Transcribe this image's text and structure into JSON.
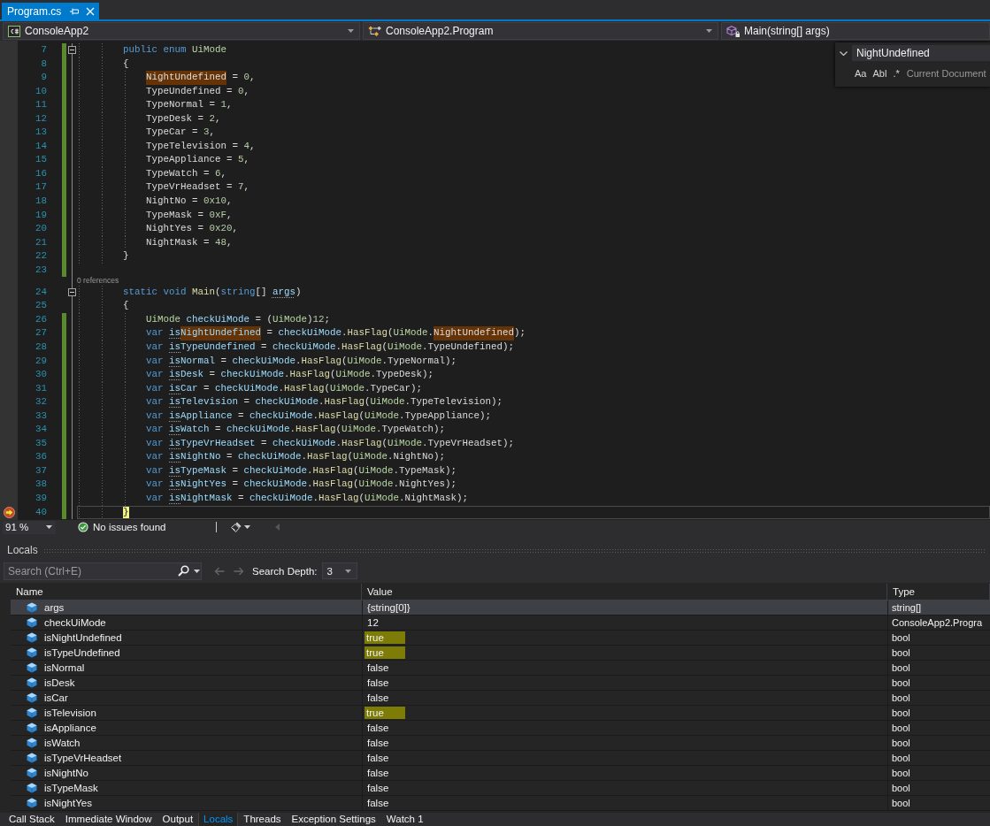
{
  "tabs": [
    {
      "label": "Program.cs",
      "selected": true
    }
  ],
  "navigation_bar": {
    "project": "ConsoleApp2",
    "type": "ConsoleApp2.Program",
    "member": "Main(string[] args)"
  },
  "editor": {
    "lines": [
      {
        "number": "7",
        "changed": true,
        "expanded": true,
        "tokens": [
          {
            "kind": "keyword",
            "text": "        public enum "
          },
          {
            "kind": "type",
            "text": "UiMode"
          }
        ]
      },
      {
        "number": "8",
        "changed": true,
        "tokens": [
          {
            "kind": "plain",
            "text": "        {"
          }
        ]
      },
      {
        "number": "9",
        "changed": true,
        "tokens": [
          {
            "kind": "member",
            "text": "            NightUndefined",
            "highlighted": true
          },
          {
            "kind": "plain",
            "text": " = "
          },
          {
            "kind": "number",
            "text": "0"
          },
          {
            "kind": "plain",
            "text": ","
          }
        ]
      },
      {
        "number": "10",
        "changed": true,
        "tokens": [
          {
            "kind": "member",
            "text": "            TypeUndefined"
          },
          {
            "kind": "plain",
            "text": " = "
          },
          {
            "kind": "number",
            "text": "0"
          },
          {
            "kind": "plain",
            "text": ","
          }
        ]
      },
      {
        "number": "11",
        "changed": true,
        "tokens": [
          {
            "kind": "member",
            "text": "            TypeNormal"
          },
          {
            "kind": "plain",
            "text": " = "
          },
          {
            "kind": "number",
            "text": "1"
          },
          {
            "kind": "plain",
            "text": ","
          }
        ]
      },
      {
        "number": "12",
        "changed": true,
        "tokens": [
          {
            "kind": "member",
            "text": "            TypeDesk"
          },
          {
            "kind": "plain",
            "text": " = "
          },
          {
            "kind": "number",
            "text": "2"
          },
          {
            "kind": "plain",
            "text": ","
          }
        ]
      },
      {
        "number": "13",
        "changed": true,
        "tokens": [
          {
            "kind": "member",
            "text": "            TypeCar"
          },
          {
            "kind": "plain",
            "text": " = "
          },
          {
            "kind": "number",
            "text": "3"
          },
          {
            "kind": "plain",
            "text": ","
          }
        ]
      },
      {
        "number": "14",
        "changed": true,
        "tokens": [
          {
            "kind": "member",
            "text": "            TypeTelevision"
          },
          {
            "kind": "plain",
            "text": " = "
          },
          {
            "kind": "number",
            "text": "4"
          },
          {
            "kind": "plain",
            "text": ","
          }
        ]
      },
      {
        "number": "15",
        "changed": true,
        "tokens": [
          {
            "kind": "member",
            "text": "            TypeAppliance"
          },
          {
            "kind": "plain",
            "text": " = "
          },
          {
            "kind": "number",
            "text": "5"
          },
          {
            "kind": "plain",
            "text": ","
          }
        ]
      },
      {
        "number": "16",
        "changed": true,
        "tokens": [
          {
            "kind": "member",
            "text": "            TypeWatch"
          },
          {
            "kind": "plain",
            "text": " = "
          },
          {
            "kind": "number",
            "text": "6"
          },
          {
            "kind": "plain",
            "text": ","
          }
        ]
      },
      {
        "number": "17",
        "changed": true,
        "tokens": [
          {
            "kind": "member",
            "text": "            TypeVrHeadset"
          },
          {
            "kind": "plain",
            "text": " = "
          },
          {
            "kind": "number",
            "text": "7"
          },
          {
            "kind": "plain",
            "text": ","
          }
        ]
      },
      {
        "number": "18",
        "changed": true,
        "tokens": [
          {
            "kind": "member",
            "text": "            NightNo"
          },
          {
            "kind": "plain",
            "text": " = "
          },
          {
            "kind": "number",
            "text": "0x10"
          },
          {
            "kind": "plain",
            "text": ","
          }
        ]
      },
      {
        "number": "19",
        "changed": true,
        "tokens": [
          {
            "kind": "member",
            "text": "            TypeMask"
          },
          {
            "kind": "plain",
            "text": " = "
          },
          {
            "kind": "number",
            "text": "0xF"
          },
          {
            "kind": "plain",
            "text": ","
          }
        ]
      },
      {
        "number": "20",
        "changed": true,
        "tokens": [
          {
            "kind": "member",
            "text": "            NightYes"
          },
          {
            "kind": "plain",
            "text": " = "
          },
          {
            "kind": "number",
            "text": "0x20"
          },
          {
            "kind": "plain",
            "text": ","
          }
        ]
      },
      {
        "number": "21",
        "changed": true,
        "tokens": [
          {
            "kind": "member",
            "text": "            NightMask"
          },
          {
            "kind": "plain",
            "text": " = "
          },
          {
            "kind": "number",
            "text": "48"
          },
          {
            "kind": "plain",
            "text": ","
          }
        ]
      },
      {
        "number": "22",
        "changed": true,
        "tokens": [
          {
            "kind": "plain",
            "text": "        }"
          }
        ]
      },
      {
        "number": "23",
        "changed": true
      },
      {
        "number": "24",
        "changed": false,
        "expanded": true,
        "codelens": "0 references",
        "tokens": [
          {
            "kind": "keyword",
            "text": "        static void "
          },
          {
            "kind": "method",
            "text": "Main"
          },
          {
            "kind": "plain",
            "text": "("
          },
          {
            "kind": "keyword",
            "text": "string"
          },
          {
            "kind": "plain",
            "text": "[] "
          },
          {
            "kind": "local",
            "text": "args",
            "hint": true
          },
          {
            "kind": "plain",
            "text": ")"
          }
        ]
      },
      {
        "number": "25",
        "changed": false,
        "tokens": [
          {
            "kind": "plain",
            "text": "        {"
          }
        ]
      },
      {
        "number": "26",
        "changed": true,
        "tokens": [
          {
            "kind": "type",
            "text": "            UiMode "
          },
          {
            "kind": "local",
            "text": "checkUiMode"
          },
          {
            "kind": "plain",
            "text": " = ("
          },
          {
            "kind": "type",
            "text": "UiMode"
          },
          {
            "kind": "plain",
            "text": ")"
          },
          {
            "kind": "number",
            "text": "12"
          },
          {
            "kind": "plain",
            "text": ";"
          }
        ]
      },
      {
        "number": "27",
        "changed": true,
        "tokens": [
          {
            "kind": "keyword",
            "text": "            var "
          },
          {
            "kind": "local",
            "text": "is",
            "hint": true
          },
          {
            "kind": "local",
            "text": "NightUndefined",
            "highlighted": true
          },
          {
            "kind": "plain",
            "text": " = "
          },
          {
            "kind": "local",
            "text": "checkUiMode"
          },
          {
            "kind": "plain",
            "text": "."
          },
          {
            "kind": "method",
            "text": "HasFlag"
          },
          {
            "kind": "plain",
            "text": "("
          },
          {
            "kind": "type",
            "text": "UiMode"
          },
          {
            "kind": "plain",
            "text": "."
          },
          {
            "kind": "member",
            "text": "NightUndefined",
            "highlighted": true
          },
          {
            "kind": "plain",
            "text": ");"
          }
        ]
      },
      {
        "number": "28",
        "changed": true,
        "tokens": [
          {
            "kind": "keyword",
            "text": "            var "
          },
          {
            "kind": "local",
            "text": "is",
            "hint": true
          },
          {
            "kind": "local",
            "text": "TypeUndefined"
          },
          {
            "kind": "plain",
            "text": " = "
          },
          {
            "kind": "local",
            "text": "checkUiMode"
          },
          {
            "kind": "plain",
            "text": "."
          },
          {
            "kind": "method",
            "text": "HasFlag"
          },
          {
            "kind": "plain",
            "text": "("
          },
          {
            "kind": "type",
            "text": "UiMode"
          },
          {
            "kind": "plain",
            "text": "."
          },
          {
            "kind": "member",
            "text": "TypeUndefined"
          },
          {
            "kind": "plain",
            "text": ");"
          }
        ]
      },
      {
        "number": "29",
        "changed": true,
        "tokens": [
          {
            "kind": "keyword",
            "text": "            var "
          },
          {
            "kind": "local",
            "text": "is",
            "hint": true
          },
          {
            "kind": "local",
            "text": "Normal"
          },
          {
            "kind": "plain",
            "text": " = "
          },
          {
            "kind": "local",
            "text": "checkUiMode"
          },
          {
            "kind": "plain",
            "text": "."
          },
          {
            "kind": "method",
            "text": "HasFlag"
          },
          {
            "kind": "plain",
            "text": "("
          },
          {
            "kind": "type",
            "text": "UiMode"
          },
          {
            "kind": "plain",
            "text": "."
          },
          {
            "kind": "member",
            "text": "TypeNormal"
          },
          {
            "kind": "plain",
            "text": ");"
          }
        ]
      },
      {
        "number": "30",
        "changed": true,
        "tokens": [
          {
            "kind": "keyword",
            "text": "            var "
          },
          {
            "kind": "local",
            "text": "is",
            "hint": true
          },
          {
            "kind": "local",
            "text": "Desk"
          },
          {
            "kind": "plain",
            "text": " = "
          },
          {
            "kind": "local",
            "text": "checkUiMode"
          },
          {
            "kind": "plain",
            "text": "."
          },
          {
            "kind": "method",
            "text": "HasFlag"
          },
          {
            "kind": "plain",
            "text": "("
          },
          {
            "kind": "type",
            "text": "UiMode"
          },
          {
            "kind": "plain",
            "text": "."
          },
          {
            "kind": "member",
            "text": "TypeDesk"
          },
          {
            "kind": "plain",
            "text": ");"
          }
        ]
      },
      {
        "number": "31",
        "changed": true,
        "tokens": [
          {
            "kind": "keyword",
            "text": "            var "
          },
          {
            "kind": "local",
            "text": "is",
            "hint": true
          },
          {
            "kind": "local",
            "text": "Car"
          },
          {
            "kind": "plain",
            "text": " = "
          },
          {
            "kind": "local",
            "text": "checkUiMode"
          },
          {
            "kind": "plain",
            "text": "."
          },
          {
            "kind": "method",
            "text": "HasFlag"
          },
          {
            "kind": "plain",
            "text": "("
          },
          {
            "kind": "type",
            "text": "UiMode"
          },
          {
            "kind": "plain",
            "text": "."
          },
          {
            "kind": "member",
            "text": "TypeCar"
          },
          {
            "kind": "plain",
            "text": ");"
          }
        ]
      },
      {
        "number": "32",
        "changed": true,
        "tokens": [
          {
            "kind": "keyword",
            "text": "            var "
          },
          {
            "kind": "local",
            "text": "is",
            "hint": true
          },
          {
            "kind": "local",
            "text": "Television"
          },
          {
            "kind": "plain",
            "text": " = "
          },
          {
            "kind": "local",
            "text": "checkUiMode"
          },
          {
            "kind": "plain",
            "text": "."
          },
          {
            "kind": "method",
            "text": "HasFlag"
          },
          {
            "kind": "plain",
            "text": "("
          },
          {
            "kind": "type",
            "text": "UiMode"
          },
          {
            "kind": "plain",
            "text": "."
          },
          {
            "kind": "member",
            "text": "TypeTelevision"
          },
          {
            "kind": "plain",
            "text": ");"
          }
        ]
      },
      {
        "number": "33",
        "changed": true,
        "tokens": [
          {
            "kind": "keyword",
            "text": "            var "
          },
          {
            "kind": "local",
            "text": "is",
            "hint": true
          },
          {
            "kind": "local",
            "text": "Appliance"
          },
          {
            "kind": "plain",
            "text": " = "
          },
          {
            "kind": "local",
            "text": "checkUiMode"
          },
          {
            "kind": "plain",
            "text": "."
          },
          {
            "kind": "method",
            "text": "HasFlag"
          },
          {
            "kind": "plain",
            "text": "("
          },
          {
            "kind": "type",
            "text": "UiMode"
          },
          {
            "kind": "plain",
            "text": "."
          },
          {
            "kind": "member",
            "text": "TypeAppliance"
          },
          {
            "kind": "plain",
            "text": ");"
          }
        ]
      },
      {
        "number": "34",
        "changed": true,
        "tokens": [
          {
            "kind": "keyword",
            "text": "            var "
          },
          {
            "kind": "local",
            "text": "is",
            "hint": true
          },
          {
            "kind": "local",
            "text": "Watch"
          },
          {
            "kind": "plain",
            "text": " = "
          },
          {
            "kind": "local",
            "text": "checkUiMode"
          },
          {
            "kind": "plain",
            "text": "."
          },
          {
            "kind": "method",
            "text": "HasFlag"
          },
          {
            "kind": "plain",
            "text": "("
          },
          {
            "kind": "type",
            "text": "UiMode"
          },
          {
            "kind": "plain",
            "text": "."
          },
          {
            "kind": "member",
            "text": "TypeWatch"
          },
          {
            "kind": "plain",
            "text": ");"
          }
        ]
      },
      {
        "number": "35",
        "changed": true,
        "tokens": [
          {
            "kind": "keyword",
            "text": "            var "
          },
          {
            "kind": "local",
            "text": "is",
            "hint": true
          },
          {
            "kind": "local",
            "text": "TypeVrHeadset"
          },
          {
            "kind": "plain",
            "text": " = "
          },
          {
            "kind": "local",
            "text": "checkUiMode"
          },
          {
            "kind": "plain",
            "text": "."
          },
          {
            "kind": "method",
            "text": "HasFlag"
          },
          {
            "kind": "plain",
            "text": "("
          },
          {
            "kind": "type",
            "text": "UiMode"
          },
          {
            "kind": "plain",
            "text": "."
          },
          {
            "kind": "member",
            "text": "TypeVrHeadset"
          },
          {
            "kind": "plain",
            "text": ");"
          }
        ]
      },
      {
        "number": "36",
        "changed": true,
        "tokens": [
          {
            "kind": "keyword",
            "text": "            var "
          },
          {
            "kind": "local",
            "text": "is",
            "hint": true
          },
          {
            "kind": "local",
            "text": "NightNo"
          },
          {
            "kind": "plain",
            "text": " = "
          },
          {
            "kind": "local",
            "text": "checkUiMode"
          },
          {
            "kind": "plain",
            "text": "."
          },
          {
            "kind": "method",
            "text": "HasFlag"
          },
          {
            "kind": "plain",
            "text": "("
          },
          {
            "kind": "type",
            "text": "UiMode"
          },
          {
            "kind": "plain",
            "text": "."
          },
          {
            "kind": "member",
            "text": "NightNo"
          },
          {
            "kind": "plain",
            "text": ");"
          }
        ]
      },
      {
        "number": "37",
        "changed": true,
        "tokens": [
          {
            "kind": "keyword",
            "text": "            var "
          },
          {
            "kind": "local",
            "text": "is",
            "hint": true
          },
          {
            "kind": "local",
            "text": "TypeMask"
          },
          {
            "kind": "plain",
            "text": " = "
          },
          {
            "kind": "local",
            "text": "checkUiMode"
          },
          {
            "kind": "plain",
            "text": "."
          },
          {
            "kind": "method",
            "text": "HasFlag"
          },
          {
            "kind": "plain",
            "text": "("
          },
          {
            "kind": "type",
            "text": "UiMode"
          },
          {
            "kind": "plain",
            "text": "."
          },
          {
            "kind": "member",
            "text": "TypeMask"
          },
          {
            "kind": "plain",
            "text": ");"
          }
        ]
      },
      {
        "number": "38",
        "changed": true,
        "tokens": [
          {
            "kind": "keyword",
            "text": "            var "
          },
          {
            "kind": "local",
            "text": "is",
            "hint": true
          },
          {
            "kind": "local",
            "text": "NightYes"
          },
          {
            "kind": "plain",
            "text": " = "
          },
          {
            "kind": "local",
            "text": "checkUiMode"
          },
          {
            "kind": "plain",
            "text": "."
          },
          {
            "kind": "method",
            "text": "HasFlag"
          },
          {
            "kind": "plain",
            "text": "("
          },
          {
            "kind": "type",
            "text": "UiMode"
          },
          {
            "kind": "plain",
            "text": "."
          },
          {
            "kind": "member",
            "text": "NightYes"
          },
          {
            "kind": "plain",
            "text": ");"
          }
        ]
      },
      {
        "number": "39",
        "changed": true,
        "tokens": [
          {
            "kind": "keyword",
            "text": "            var "
          },
          {
            "kind": "local",
            "text": "is",
            "hint": true
          },
          {
            "kind": "local",
            "text": "NightMask"
          },
          {
            "kind": "plain",
            "text": " = "
          },
          {
            "kind": "local",
            "text": "checkUiMode"
          },
          {
            "kind": "plain",
            "text": "."
          },
          {
            "kind": "method",
            "text": "HasFlag"
          },
          {
            "kind": "plain",
            "text": "("
          },
          {
            "kind": "type",
            "text": "UiMode"
          },
          {
            "kind": "plain",
            "text": "."
          },
          {
            "kind": "member",
            "text": "NightMask"
          },
          {
            "kind": "plain",
            "text": ");"
          }
        ]
      },
      {
        "number": "40",
        "changed": true,
        "breakpoint": true,
        "current": true,
        "tokens": [
          {
            "kind": "plain",
            "text": "        }"
          }
        ]
      }
    ]
  },
  "find_widget": {
    "query": "NightUndefined",
    "options": [
      {
        "label": "Aa",
        "selected": false
      },
      {
        "label": "Abl",
        "selected": false
      },
      {
        "label": ".*",
        "selected": false
      }
    ],
    "scope": "Current Document"
  },
  "editor_status": {
    "zoom": "91 %",
    "issues": "No issues found"
  },
  "locals": {
    "title": "Locals",
    "search": {
      "placeholder": "Search (Ctrl+E)"
    },
    "history_disabled": true,
    "search_depth_label": "Search Depth:",
    "search_depth": "3",
    "columns": [
      "Name",
      "Value",
      "Type"
    ],
    "rows": [
      {
        "name": "args",
        "value": "{string[0]}",
        "type": "string[]",
        "selected": true,
        "highlighted": false
      },
      {
        "name": "checkUiMode",
        "value": "12",
        "type": "ConsoleApp2.Progra",
        "selected": false,
        "highlighted": false
      },
      {
        "name": "isNightUndefined",
        "value": "true",
        "type": "bool",
        "selected": false,
        "highlighted": true
      },
      {
        "name": "isTypeUndefined",
        "value": "true",
        "type": "bool",
        "selected": false,
        "highlighted": true
      },
      {
        "name": "isNormal",
        "value": "false",
        "type": "bool",
        "selected": false,
        "highlighted": false
      },
      {
        "name": "isDesk",
        "value": "false",
        "type": "bool",
        "selected": false,
        "highlighted": false
      },
      {
        "name": "isCar",
        "value": "false",
        "type": "bool",
        "selected": false,
        "highlighted": false
      },
      {
        "name": "isTelevision",
        "value": "true",
        "type": "bool",
        "selected": false,
        "highlighted": true
      },
      {
        "name": "isAppliance",
        "value": "false",
        "type": "bool",
        "selected": false,
        "highlighted": false
      },
      {
        "name": "isWatch",
        "value": "false",
        "type": "bool",
        "selected": false,
        "highlighted": false
      },
      {
        "name": "isTypeVrHeadset",
        "value": "false",
        "type": "bool",
        "selected": false,
        "highlighted": false
      },
      {
        "name": "isNightNo",
        "value": "false",
        "type": "bool",
        "selected": false,
        "highlighted": false
      },
      {
        "name": "isTypeMask",
        "value": "false",
        "type": "bool",
        "selected": false,
        "highlighted": false
      },
      {
        "name": "isNightYes",
        "value": "false",
        "type": "bool",
        "selected": false,
        "highlighted": false
      }
    ]
  },
  "tool_tabs": [
    {
      "label": "Call Stack",
      "selected": false
    },
    {
      "label": "Immediate Window",
      "selected": false
    },
    {
      "label": "Output",
      "selected": false
    },
    {
      "label": "Locals",
      "selected": true
    },
    {
      "label": "Threads",
      "selected": false
    },
    {
      "label": "Exception Settings",
      "selected": false
    },
    {
      "label": "Watch 1",
      "selected": false
    }
  ]
}
